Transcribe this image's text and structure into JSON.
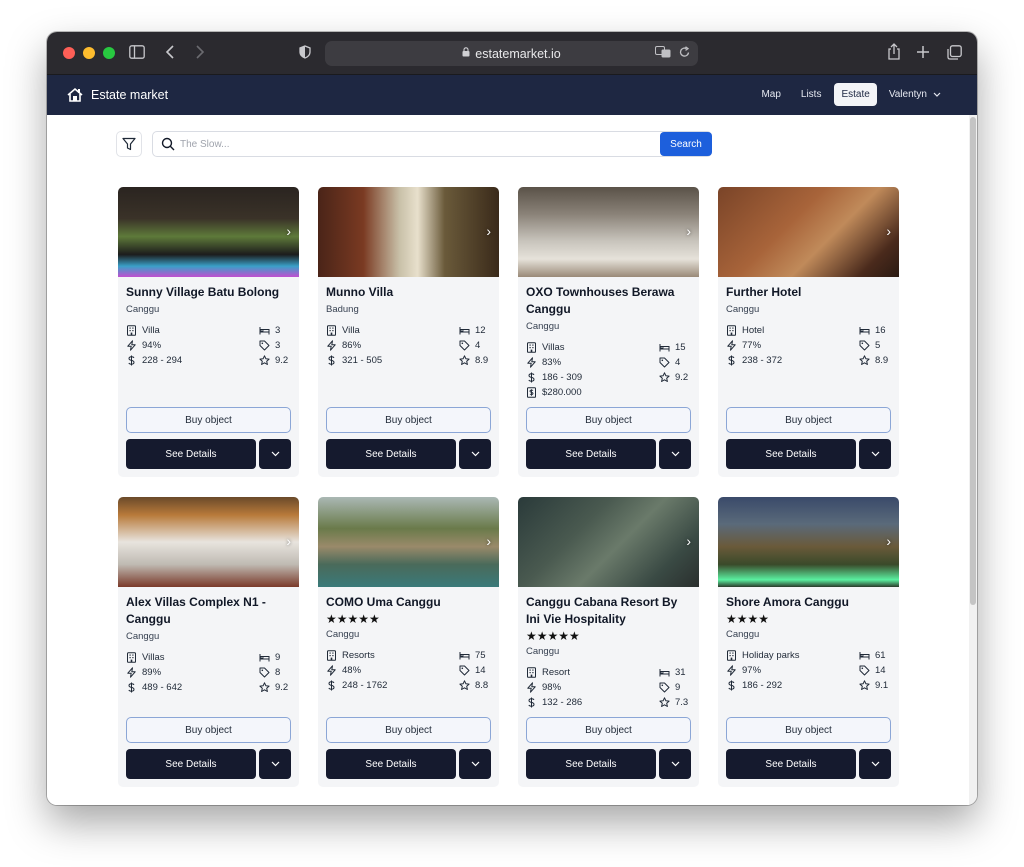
{
  "browser": {
    "url": "estatemarket.io"
  },
  "nav": {
    "brand": "Estate market",
    "links": [
      "Map",
      "Lists",
      "Estate"
    ],
    "active": "Estate",
    "user": "Valentyn"
  },
  "search": {
    "placeholder": "The Slow...",
    "button_label": "Search"
  },
  "buttons": {
    "buy": "Buy object",
    "details": "See Details"
  },
  "listings": [
    {
      "title": "Sunny Village Batu Bolong",
      "stars": "",
      "location": "Canggu",
      "type": "Villa",
      "occupancy": "94%",
      "price_range": "228 - 294",
      "price": "",
      "rooms": "3",
      "tags": "3",
      "rating": "9.2"
    },
    {
      "title": "Munno Villa",
      "stars": "",
      "location": "Badung",
      "type": "Villa",
      "occupancy": "86%",
      "price_range": "321 - 505",
      "price": "",
      "rooms": "12",
      "tags": "4",
      "rating": "8.9"
    },
    {
      "title": "OXO Townhouses Berawa Canggu",
      "stars": "",
      "location": "Canggu",
      "type": "Villas",
      "occupancy": "83%",
      "price_range": "186 - 309",
      "price": "$280.000",
      "rooms": "15",
      "tags": "4",
      "rating": "9.2"
    },
    {
      "title": "Further Hotel",
      "stars": "",
      "location": "Canggu",
      "type": "Hotel",
      "occupancy": "77%",
      "price_range": "238 - 372",
      "price": "",
      "rooms": "16",
      "tags": "5",
      "rating": "8.9"
    },
    {
      "title": "Alex Villas Complex N1 - Canggu",
      "stars": "",
      "location": "Canggu",
      "type": "Villas",
      "occupancy": "89%",
      "price_range": "489 - 642",
      "price": "",
      "rooms": "9",
      "tags": "8",
      "rating": "9.2"
    },
    {
      "title": "COMO Uma Canggu",
      "stars": "★★★★★",
      "location": "Canggu",
      "type": "Resorts",
      "occupancy": "48%",
      "price_range": "248 - 1762",
      "price": "",
      "rooms": "75",
      "tags": "14",
      "rating": "8.8"
    },
    {
      "title": "Canggu Cabana Resort By Ini Vie Hospitality",
      "stars": "★★★★★",
      "location": "Canggu",
      "type": "Resort",
      "occupancy": "98%",
      "price_range": "132 - 286",
      "price": "",
      "rooms": "31",
      "tags": "9",
      "rating": "7.3"
    },
    {
      "title": "Shore Amora Canggu",
      "stars": "★★★★",
      "location": "Canggu",
      "type": "Holiday parks",
      "occupancy": "97%",
      "price_range": "186 - 292",
      "price": "",
      "rooms": "61",
      "tags": "14",
      "rating": "9.1"
    }
  ],
  "colors": {
    "nav_bg": "#1e2742",
    "search_button": "#1d5fdc",
    "details_button": "#151a2e",
    "card_bg": "#f4f5f7"
  }
}
